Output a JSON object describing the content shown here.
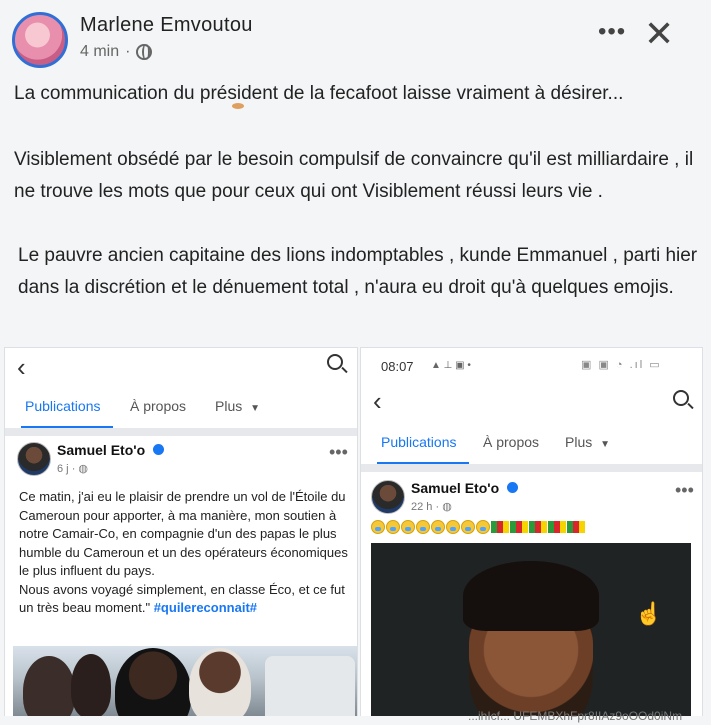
{
  "post": {
    "author": "Marlene Emvoutou",
    "time": "4 min",
    "paragraphs": [
      "La communication  du président  de la fecafoot  laisse  vraiment  à désirer...",
      "Visiblement  obsédé  par le besoin compulsif  de convaincre qu'il est milliardaire , il ne trouve les mots que pour ceux qui ont Visiblement réussi leurs vie .",
      "Le pauvre ancien capitaine  des lions indomptables , kunde Emmanuel , parti hier dans la discrétion  et le dénuement  total , n'aura eu  droit qu'à  quelques emojis."
    ],
    "more_icon": "more-icon",
    "close_icon": "close-icon",
    "globe_icon": "globe-icon"
  },
  "left_screenshot": {
    "tabs": [
      "Publications",
      "À propos",
      "Plus"
    ],
    "author": "Samuel Eto'o",
    "time": "6 j",
    "text": "Ce matin, j'ai eu le plaisir de prendre un vol de l'Étoile du Cameroun pour apporter, à ma manière, mon soutien à notre Camair-Co, en compagnie d'un des papas le plus humble du Cameroun et un des opérateurs économiques le plus influent du pays.\nNous avons voyagé simplement, en classe Éco, et ce fut un très beau moment.\"",
    "hashtag": "#quilereconnait#"
  },
  "right_screenshot": {
    "status_time": "08:07",
    "tabs": [
      "Publications",
      "À propos",
      "Plus"
    ],
    "author": "Samuel Eto'o",
    "time": "22 h"
  },
  "footer_text": "...ihIcf... UFEMBXhFpr8IIAz9oOOd0iNm"
}
